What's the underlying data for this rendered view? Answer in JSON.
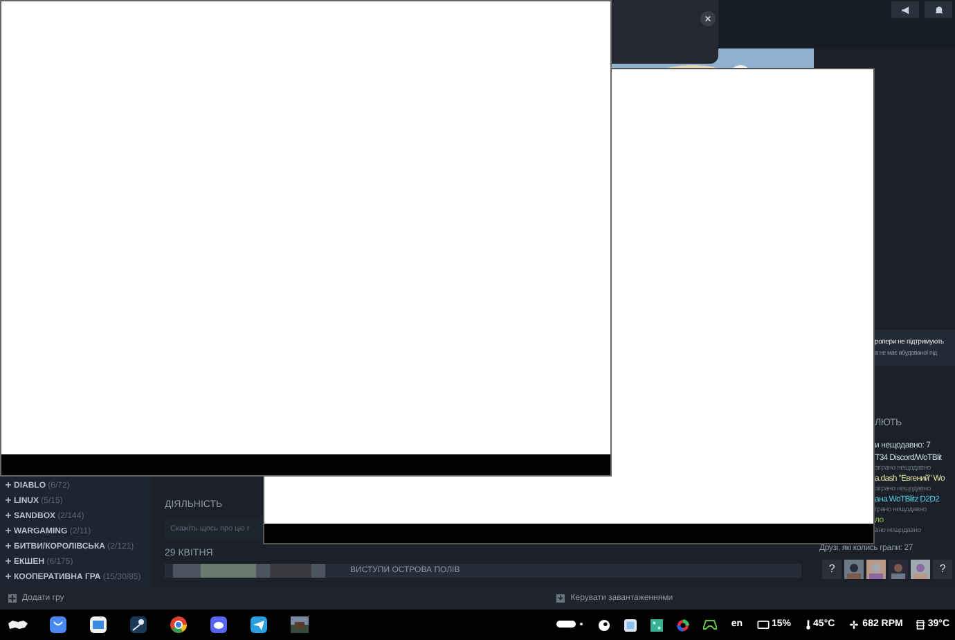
{
  "sidebar": {
    "categories": [
      {
        "name": "DIABLO",
        "count": "(6/72)"
      },
      {
        "name": "LINUX",
        "count": "(5/15)"
      },
      {
        "name": "SANDBOX",
        "count": "(2/144)"
      },
      {
        "name": "WARGAMING",
        "count": "(2/11)"
      },
      {
        "name": "БИТВИ/КОРОЛІВСЬКА",
        "count": "(2/121)"
      },
      {
        "name": "ЕКШЕН",
        "count": "(6/175)"
      },
      {
        "name": "КООПЕРАТИВНА ГРА",
        "count": "(15/30/85)"
      }
    ]
  },
  "activity": {
    "title": "ДІЯЛЬНІСТЬ",
    "placeholder": "Скажіть щось про цю г"
  },
  "news": {
    "date": "29 КВІТНЯ",
    "title": "ВИСТУПИ ОСТРОВА ПОЛІВ"
  },
  "right_panel": {
    "notice": [
      "ропери не підтримують",
      "а не має вбудованої під"
    ],
    "section_title": "ЛЮТЬ",
    "recent_title": "и нещодавно: 7",
    "friends": [
      {
        "name": "T34 Discord/WoTBlit",
        "status": "зіграно нещодавно",
        "color": "#c6d4df"
      },
      {
        "name": "a.dash \"Евгений\" Wo",
        "status": "зіграно нещодавно",
        "color": "#e4e0a0"
      },
      {
        "name": "ана WoTBlitz D2D2",
        "status": "грано нещодавно",
        "color": "#57cbde"
      },
      {
        "name": "ло",
        "status": "ано нещодавно",
        "color": "#90ba3c"
      }
    ],
    "past_title": "Друзі, які колись грали: 27",
    "avatars": [
      {
        "kind": "unknown",
        "label": "?"
      },
      {
        "kind": "picture"
      },
      {
        "kind": "picture"
      },
      {
        "kind": "picture"
      },
      {
        "kind": "picture"
      },
      {
        "kind": "unknown",
        "label": "?"
      }
    ]
  },
  "bottom_bar": {
    "add_game": "Додати гру",
    "downloads": "Керувати завантаженнями"
  },
  "taskbar": {
    "language": "en",
    "battery": "15%",
    "cpu_temp": "45°C",
    "fan": "682 RPM",
    "gpu_temp": "39°C"
  }
}
